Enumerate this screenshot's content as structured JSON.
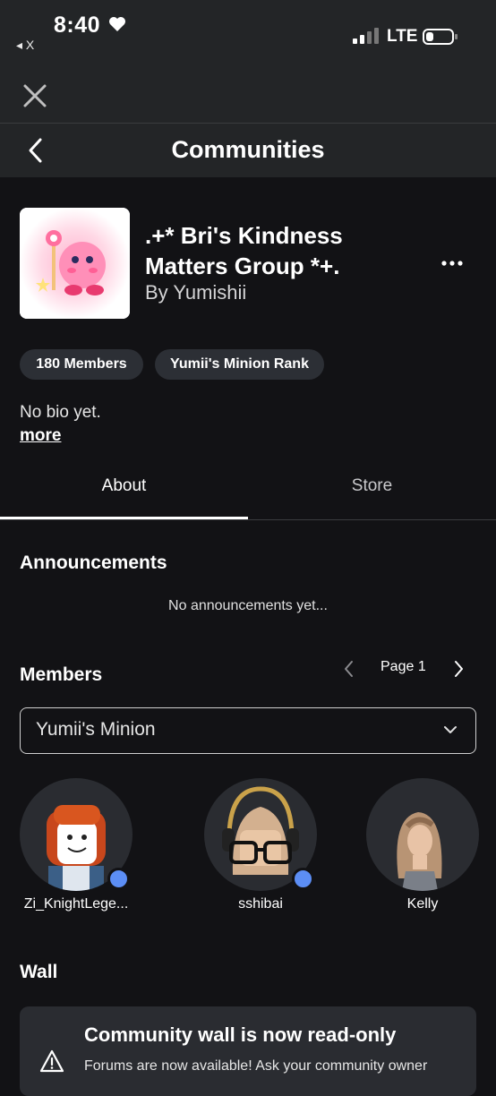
{
  "status_bar": {
    "time": "8:40",
    "back_app": "◂ X",
    "network": "LTE"
  },
  "header": {
    "title": "Communities"
  },
  "group": {
    "name": ".+* Bri's Kindness Matters Group *+.",
    "owner": "By Yumishii",
    "members_pill": "180 Members",
    "rank_pill": "Yumii's Minion Rank",
    "bio": "No bio yet.",
    "more_label": "more"
  },
  "tabs": [
    {
      "label": "About",
      "active": true
    },
    {
      "label": "Store",
      "active": false
    }
  ],
  "announcements": {
    "title": "Announcements",
    "empty": "No announcements yet..."
  },
  "members": {
    "title": "Members",
    "page_label": "Page 1",
    "rank_selected": "Yumii's Minion",
    "list": [
      {
        "name": "Zi_KnightLege...",
        "online": true
      },
      {
        "name": "sshibai",
        "online": true
      },
      {
        "name": "Kelly",
        "online": false
      }
    ]
  },
  "wall": {
    "title": "Wall",
    "notice_title": "Community wall is now read-only",
    "notice_text": "Forums are now available! Ask your community owner"
  },
  "colors": {
    "background": "#121215",
    "bar": "#232527",
    "pill": "#2c2f35",
    "online": "#5c8ef5"
  }
}
